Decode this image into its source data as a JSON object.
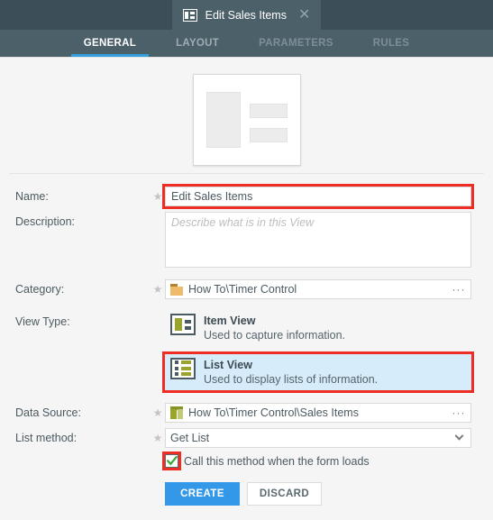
{
  "window": {
    "tab": {
      "icon": "list-view-icon",
      "title": "Edit Sales Items",
      "close_label": "✕"
    },
    "nav_tabs": [
      {
        "label": "GENERAL",
        "active": true
      },
      {
        "label": "LAYOUT",
        "active": false
      },
      {
        "label": "PARAMETERS",
        "active": false
      },
      {
        "label": "RULES",
        "active": false
      }
    ]
  },
  "preview": {
    "name": "view-layout-preview"
  },
  "form": {
    "name": {
      "label": "Name:",
      "required_marker": "★",
      "value": "Edit Sales Items",
      "placeholder": ""
    },
    "description": {
      "label": "Description:",
      "value": "",
      "placeholder": "Describe what is in this View"
    },
    "category": {
      "label": "Category:",
      "required_marker": "★",
      "value": "How To\\Timer Control",
      "icon": "folder-icon",
      "ellipsis": "···"
    },
    "view_type": {
      "label": "View Type:",
      "options": [
        {
          "title": "Item View",
          "description": "Used to capture information.",
          "icon": "item-view-icon",
          "selected": false
        },
        {
          "title": "List View",
          "description": "Used to display lists of information.",
          "icon": "list-view-icon",
          "selected": true
        }
      ]
    },
    "data_source": {
      "label": "Data Source:",
      "required_marker": "★",
      "value": "How To\\Timer Control\\Sales Items",
      "icon": "cube-icon",
      "ellipsis": "···"
    },
    "list_method": {
      "label": "List method:",
      "required_marker": "★",
      "value": "Get List",
      "options": [
        "Get List"
      ]
    },
    "call_on_load": {
      "label": "Call this method when the form loads",
      "checked": true
    }
  },
  "footer": {
    "create_label": "CREATE",
    "discard_label": "DISCARD"
  },
  "colors": {
    "topbar": "#3c4f58",
    "navbar": "#4c6069",
    "accent": "#33a0dd",
    "primary_button": "#3498e8",
    "highlight_red": "#ee2d24",
    "selection_blue": "#d7ecfa",
    "icon_olive": "#9aa32b",
    "folder_tan": "#edbb6a"
  }
}
